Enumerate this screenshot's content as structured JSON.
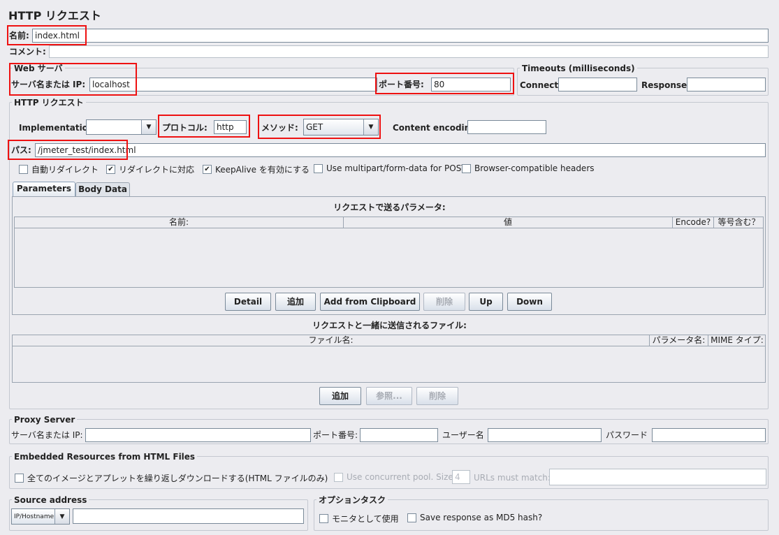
{
  "title": "HTTP リクエスト",
  "name": {
    "label": "名前:",
    "value": "index.html"
  },
  "comment": {
    "label": "コメント:",
    "value": ""
  },
  "web_server": {
    "title": "Web サーバ",
    "server_label": "サーバ名または IP:",
    "server_value": "localhost",
    "port_label": "ポート番号:",
    "port_value": "80"
  },
  "timeouts": {
    "title": "Timeouts (milliseconds)",
    "connect_label": "Connect:",
    "connect_value": "",
    "response_label": "Response:",
    "response_value": ""
  },
  "http_request": {
    "title": "HTTP リクエスト",
    "implementation_label": "Implementation:",
    "implementation_value": "",
    "protocol_label": "プロトコル:",
    "protocol_value": "http",
    "method_label": "メソッド:",
    "method_value": "GET",
    "encoding_label": "Content encoding:",
    "encoding_value": "",
    "path_label": "パス:",
    "path_value": "/jmeter_test/index.html"
  },
  "checkboxes": [
    {
      "label": "自動リダイレクト",
      "checked": false
    },
    {
      "label": "リダイレクトに対応",
      "checked": true
    },
    {
      "label": "KeepAlive を有効にする",
      "checked": true
    },
    {
      "label": "Use multipart/form-data for POST",
      "checked": false
    },
    {
      "label": "Browser-compatible headers",
      "checked": false
    }
  ],
  "tabs": [
    {
      "label": "Parameters",
      "active": true
    },
    {
      "label": "Body Data",
      "active": false
    }
  ],
  "parameters": {
    "caption": "リクエストで送るパラメータ:",
    "columns": [
      "名前:",
      "値",
      "Encode?",
      "等号含む？"
    ],
    "buttons": [
      "Detail",
      "追加",
      "Add from Clipboard",
      "削除",
      "Up",
      "Down"
    ]
  },
  "files": {
    "caption": "リクエストと一緒に送信されるファイル:",
    "columns": [
      "ファイル名:",
      "パラメータ名:",
      "MIME タイプ:"
    ],
    "buttons": [
      "追加",
      "参照...",
      "削除"
    ]
  },
  "proxy": {
    "title": "Proxy Server",
    "server_label": "サーバ名または IP:",
    "port_label": "ポート番号:",
    "user_label": "ユーザー名",
    "password_label": "パスワード"
  },
  "embedded": {
    "title": "Embedded Resources from HTML Files",
    "download_label": "全てのイメージとアプレットを繰り返しダウンロードする(HTML ファイルのみ)",
    "pool_label": "Use concurrent pool. Size:",
    "pool_value": "4",
    "urls_label": "URLs must match:"
  },
  "source": {
    "title": "Source address",
    "type_value": "IP/Hostname",
    "value": ""
  },
  "options": {
    "title": "オプションタスク",
    "monitor_label": "モニタとして使用",
    "md5_label": "Save response as MD5 hash?"
  },
  "colors": {
    "highlight": "#ee1111",
    "panel": "#ececf0"
  }
}
